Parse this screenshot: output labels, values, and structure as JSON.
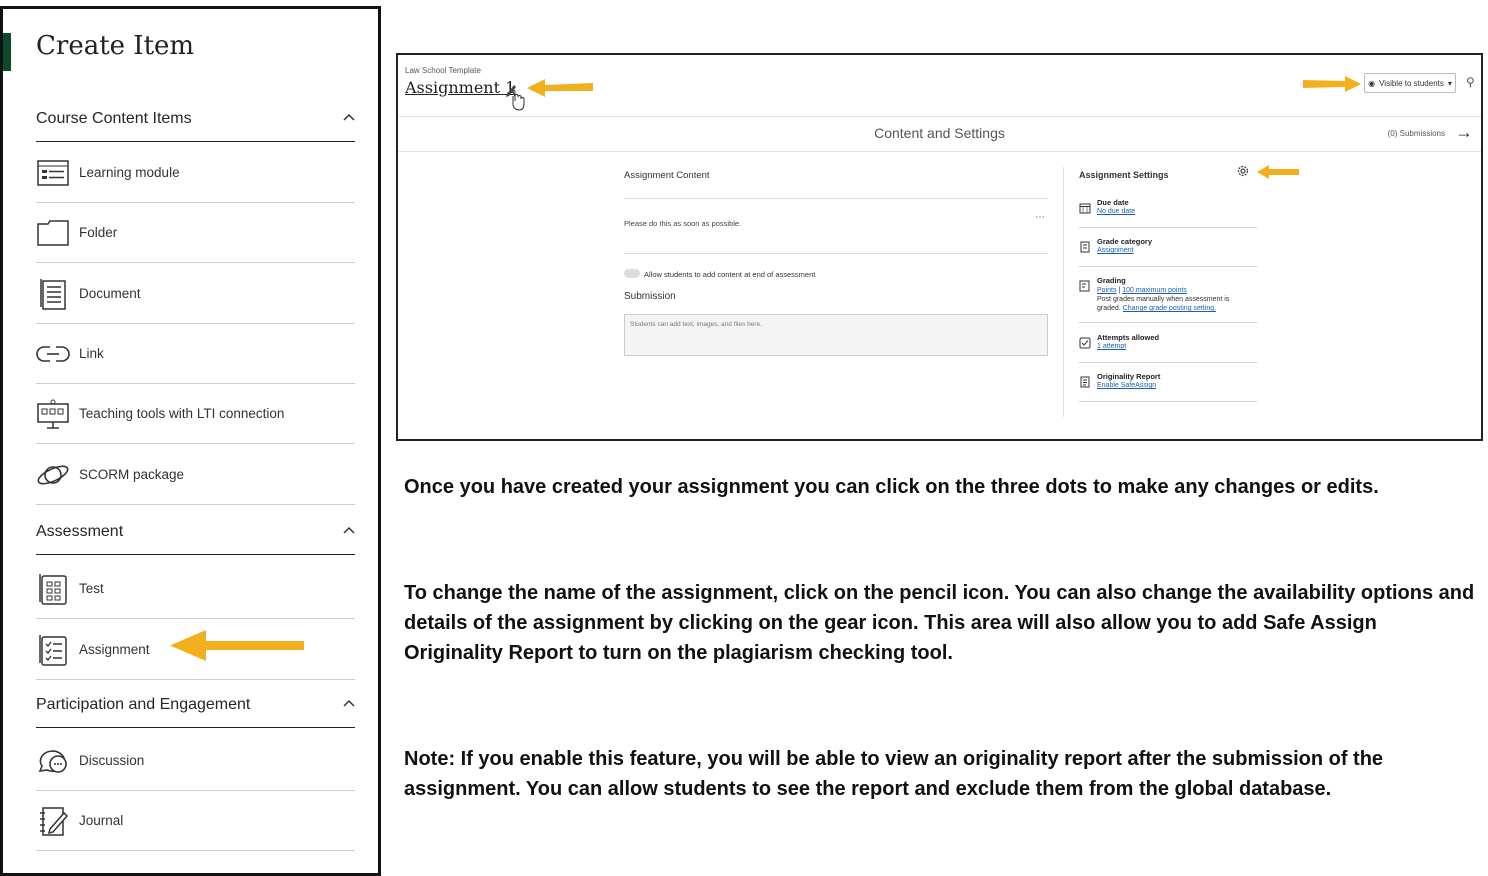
{
  "panel": {
    "title": "Create Item",
    "sections": [
      {
        "label": "Course Content Items"
      },
      {
        "label": "Assessment"
      },
      {
        "label": "Participation and Engagement"
      }
    ],
    "items": [
      {
        "label": "Learning module",
        "icon": "learning-module-icon"
      },
      {
        "label": "Folder",
        "icon": "folder-icon"
      },
      {
        "label": "Document",
        "icon": "document-icon"
      },
      {
        "label": "Link",
        "icon": "link-icon"
      },
      {
        "label": "Teaching tools with LTI connection",
        "icon": "lti-icon"
      },
      {
        "label": "SCORM package",
        "icon": "scorm-icon"
      },
      {
        "label": "Test",
        "icon": "test-icon"
      },
      {
        "label": "Assignment",
        "icon": "assignment-icon"
      },
      {
        "label": "Discussion",
        "icon": "discussion-icon"
      },
      {
        "label": "Journal",
        "icon": "journal-icon"
      }
    ]
  },
  "shot": {
    "breadcrumb": "Law School Template",
    "title": "Assignment 1",
    "visibility": "Visible to students",
    "header_center": "Content and Settings",
    "submissions": "(0) Submissions",
    "content_label": "Assignment Content",
    "content_text": "Please do this as soon as possible.",
    "toggle_label": "Allow students to add content at end of assessment",
    "submission_label": "Submission",
    "submission_placeholder": "Students can add text, images, and files here.",
    "settings_title": "Assignment Settings",
    "settings": {
      "due_title": "Due date",
      "due_link": "No due date",
      "grade_cat_title": "Grade category",
      "grade_cat_link": "Assignment",
      "grading_title": "Grading",
      "grading_link1": "Points",
      "grading_sep": "|",
      "grading_link2": "100 maximum points",
      "grading_text1": "Post grades manually when assessment is",
      "grading_text2": "graded.",
      "grading_link3": "Change grade posting setting.",
      "attempts_title": "Attempts allowed",
      "attempts_link": "1 attempt",
      "orig_title": "Originality Report",
      "orig_link": "Enable SafeAssign"
    }
  },
  "paragraphs": {
    "p1": "Once you have created your assignment you can click on the three dots to make any changes or edits.",
    "p2": "To change the name of the assignment, click on the pencil icon. You can also change the availability options and details of the assignment by clicking on the gear icon. This area will also allow you to add Safe Assign Originality Report to turn on the plagiarism checking tool.",
    "p3": "Note: If you enable this feature, you will be able to view an originality report after the submission of the assignment. You can allow students to see the report and exclude them from the global database."
  },
  "colors": {
    "arrow": "#f2b01e",
    "accent": "#0e4a2a",
    "link": "#1a5fb4"
  }
}
